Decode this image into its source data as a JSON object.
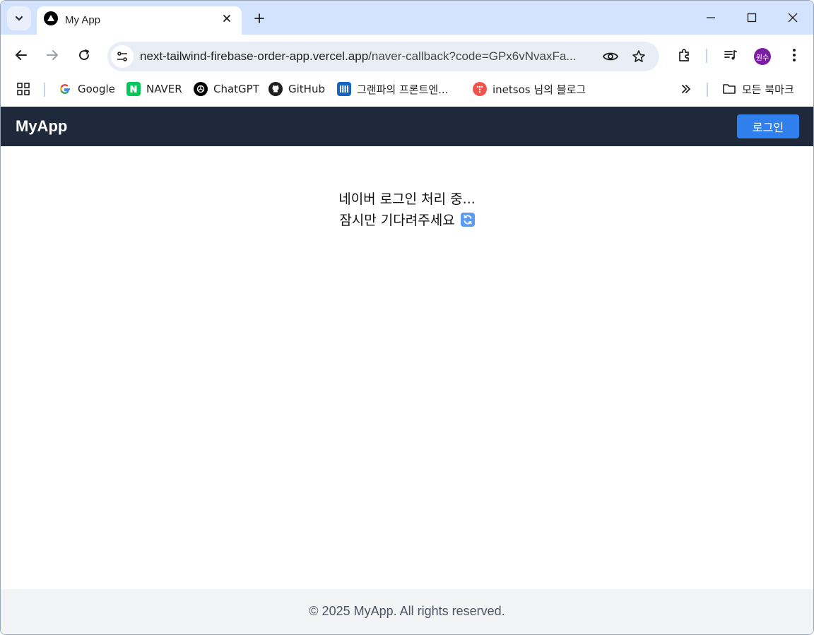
{
  "browser": {
    "tab": {
      "title": "My App"
    },
    "url": {
      "host": "next-tailwind-firebase-order-app.vercel.app",
      "path": "/naver-callback?code=GPx6vNvaxFa..."
    },
    "profile_initials": "원수",
    "bookmarks": [
      {
        "label": "Google"
      },
      {
        "label": "NAVER"
      },
      {
        "label": "ChatGPT"
      },
      {
        "label": "GitHub"
      },
      {
        "label": "그랜파의 프론트엔..."
      },
      {
        "label": "inetsos 님의 블로그"
      }
    ],
    "all_bookmarks_label": "모든 북마크"
  },
  "app": {
    "brand": "MyApp",
    "login_label": "로그인",
    "status_line1": "네이버 로그인 처리 중...",
    "status_line2": "잠시만 기다려주세요",
    "footer": "© 2025 MyApp. All rights reserved."
  },
  "colors": {
    "header_bg": "#1e293b",
    "login_button": "#2f80ed",
    "footer_bg": "#f3f4f6",
    "tabstrip_bg": "#d3e3fd"
  }
}
